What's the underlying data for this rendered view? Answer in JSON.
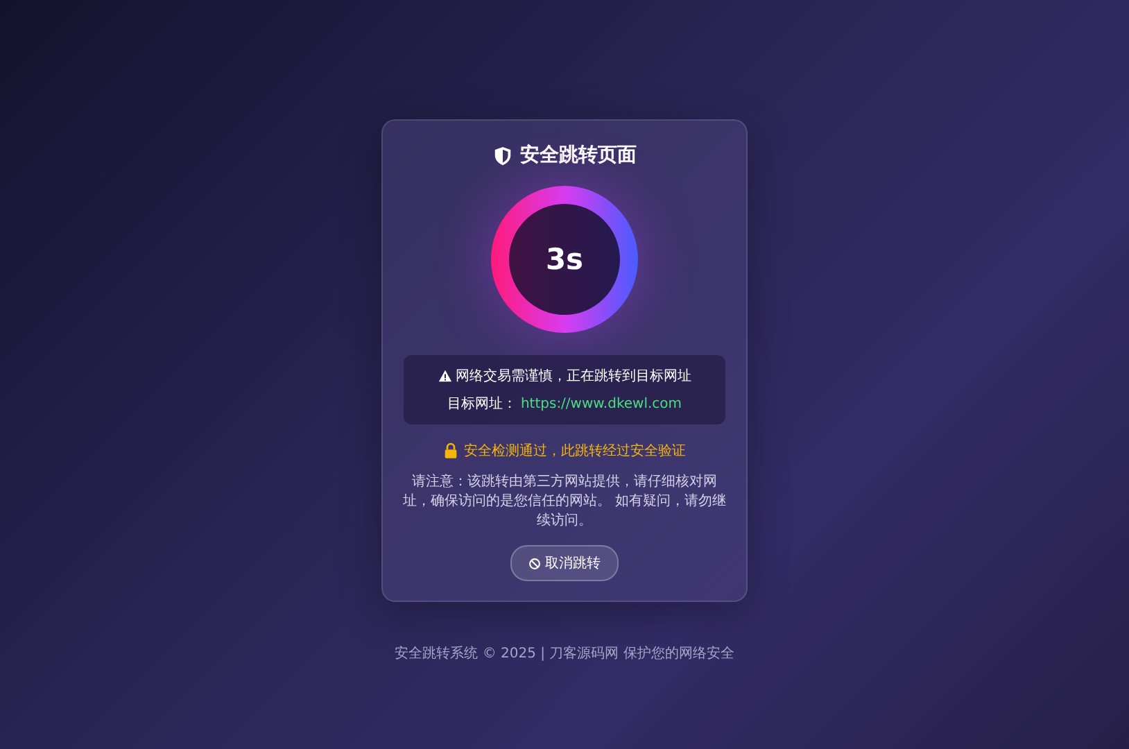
{
  "title": "安全跳转页面",
  "countdown": "3s",
  "warning": {
    "text": "网络交易需谨慎，正在跳转到目标网址",
    "url_label": "目标网址：",
    "url": "https://www.dkewl.com"
  },
  "security_notice": "安全检测通过，此跳转经过安全验证",
  "note": "请注意：该跳转由第三方网站提供，请仔细核对网址，确保访问的是您信任的网站。 如有疑问，请勿继续访问。",
  "cancel_button": "取消跳转",
  "footer": "安全跳转系统 © 2025 | 刀客源码网 保护您的网络安全"
}
